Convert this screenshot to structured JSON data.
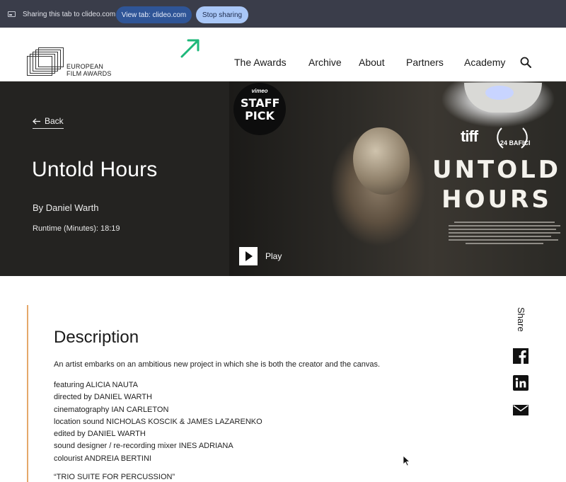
{
  "sharing_bar": {
    "status_text": "Sharing this tab to clideo.com",
    "view_tab_label": "View tab: clideo.com",
    "stop_sharing_label": "Stop sharing"
  },
  "header": {
    "logo_line1": "EUROPEAN",
    "logo_line2": "FILM AWARDS",
    "nav": [
      "The Awards",
      "Archive",
      "About",
      "Partners",
      "Academy"
    ],
    "search_icon": "search-icon"
  },
  "hero": {
    "back_label": "Back",
    "title": "Untold Hours",
    "by": "By Daniel Warth",
    "runtime": "Runtime (Minutes): 18:19",
    "play_label": "Play",
    "badge_vimeo": "vimeo",
    "badge_staff_pick": "STAFF PICK",
    "festival_tiff": "tiff",
    "festival_bafici": "24 BAFICI",
    "poster_title_line1": "UNTOLD",
    "poster_title_line2": "HOURS"
  },
  "content": {
    "heading": "Description",
    "summary": "An artist embarks on an ambitious new project in which she is both the creator and the canvas.",
    "credits": [
      "featuring ALICIA NAUTA",
      "directed by DANIEL WARTH",
      "cinematography IAN CARLETON",
      "location sound NICHOLAS KOSCIK & JAMES LAZARENKO",
      "edited by DANIEL WARTH",
      "sound designer / re-recording mixer INES ADRIANA",
      "colourist ANDREIA BERTINI"
    ],
    "music": "“TRIO SUITE FOR PERCUSSION”",
    "share_label": "Share"
  },
  "colors": {
    "share_bar_bg": "#3a3d4a",
    "view_tab_bg": "#2f5597",
    "stop_sharing_bg": "#a9c7f7",
    "accent": "#e5a86a",
    "arrow": "#1db87a"
  }
}
